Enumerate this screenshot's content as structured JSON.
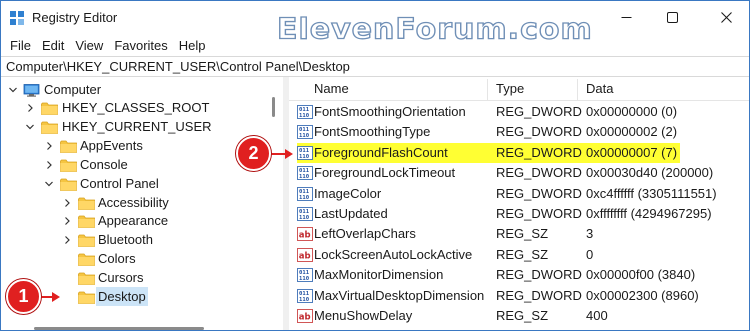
{
  "window": {
    "title": "Registry Editor",
    "watermark": "ElevenForum.com"
  },
  "menu": [
    {
      "label": "File"
    },
    {
      "label": "Edit"
    },
    {
      "label": "View"
    },
    {
      "label": "Favorites"
    },
    {
      "label": "Help"
    }
  ],
  "address": "Computer\\HKEY_CURRENT_USER\\Control Panel\\Desktop",
  "tree": [
    {
      "label": "Computer",
      "chevron": "down",
      "icon": "computer"
    },
    {
      "label": "HKEY_CLASSES_ROOT",
      "chevron": "right",
      "icon": "folder"
    },
    {
      "label": "HKEY_CURRENT_USER",
      "chevron": "down",
      "icon": "folder"
    },
    {
      "label": "AppEvents",
      "chevron": "right",
      "icon": "folder"
    },
    {
      "label": "Console",
      "chevron": "right",
      "icon": "folder"
    },
    {
      "label": "Control Panel",
      "chevron": "down",
      "icon": "folder"
    },
    {
      "label": "Accessibility",
      "chevron": "right",
      "icon": "folder"
    },
    {
      "label": "Appearance",
      "chevron": "right",
      "icon": "folder"
    },
    {
      "label": "Bluetooth",
      "chevron": "right",
      "icon": "folder"
    },
    {
      "label": "Colors",
      "chevron": "none",
      "icon": "folder"
    },
    {
      "label": "Cursors",
      "chevron": "none",
      "icon": "folder"
    },
    {
      "label": "Desktop",
      "chevron": "none",
      "icon": "folder",
      "selected": true
    }
  ],
  "columns": {
    "name": "Name",
    "type": "Type",
    "data": "Data"
  },
  "values": [
    {
      "name": "FontSmoothingOrientation",
      "type": "REG_DWORD",
      "data": "0x00000000 (0)",
      "icon": "dword-icon"
    },
    {
      "name": "FontSmoothingType",
      "type": "REG_DWORD",
      "data": "0x00000002 (2)",
      "icon": "dword-icon"
    },
    {
      "name": "ForegroundFlashCount",
      "type": "REG_DWORD",
      "data": "0x00000007 (7)",
      "icon": "dword-icon",
      "highlight": true
    },
    {
      "name": "ForegroundLockTimeout",
      "type": "REG_DWORD",
      "data": "0x00030d40 (200000)",
      "icon": "dword-icon"
    },
    {
      "name": "ImageColor",
      "type": "REG_DWORD",
      "data": "0xc4ffffff (3305111551)",
      "icon": "dword-icon"
    },
    {
      "name": "LastUpdated",
      "type": "REG_DWORD",
      "data": "0xffffffff (4294967295)",
      "icon": "dword-icon"
    },
    {
      "name": "LeftOverlapChars",
      "type": "REG_SZ",
      "data": "3",
      "icon": "string-icon"
    },
    {
      "name": "LockScreenAutoLockActive",
      "type": "REG_SZ",
      "data": "0",
      "icon": "string-icon"
    },
    {
      "name": "MaxMonitorDimension",
      "type": "REG_DWORD",
      "data": "0x00000f00 (3840)",
      "icon": "dword-icon"
    },
    {
      "name": "MaxVirtualDesktopDimension",
      "type": "REG_DWORD",
      "data": "0x00002300 (8960)",
      "icon": "dword-icon"
    },
    {
      "name": "MenuShowDelay",
      "type": "REG_SZ",
      "data": "400",
      "icon": "string-icon"
    }
  ],
  "callouts": [
    {
      "label": "1"
    },
    {
      "label": "2"
    }
  ],
  "colors": {
    "highlight": "#ffff33",
    "selection": "#cce4f7",
    "callout": "#e02020",
    "folder": "#f5c542"
  }
}
